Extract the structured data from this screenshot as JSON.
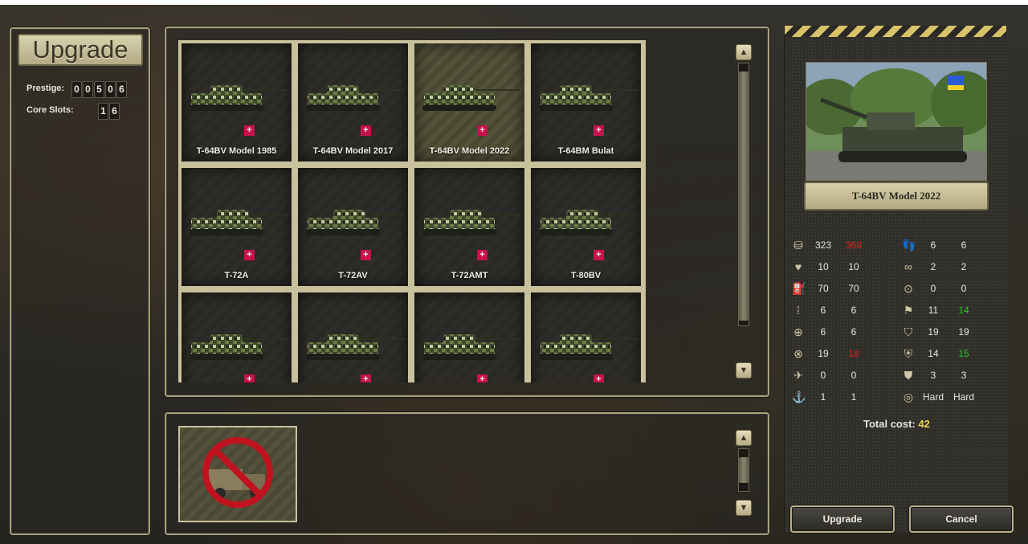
{
  "left": {
    "title": "Upgrade",
    "prestige_label": "Prestige:",
    "prestige_digits": [
      "0",
      "0",
      "5",
      "0",
      "6"
    ],
    "core_slots_label": "Core Slots:",
    "core_slots_digits": [
      "1",
      "6"
    ]
  },
  "units": [
    {
      "name": "T-64BV Model 1985",
      "selected": false
    },
    {
      "name": "T-64BV Model 2017",
      "selected": false
    },
    {
      "name": "T-64BV Model 2022",
      "selected": true
    },
    {
      "name": "T-64BM Bulat",
      "selected": false
    },
    {
      "name": "T-72A",
      "selected": false
    },
    {
      "name": "T-72AV",
      "selected": false
    },
    {
      "name": "T-72AMT",
      "selected": false
    },
    {
      "name": "T-80BV",
      "selected": false
    },
    {
      "name": "",
      "selected": false
    },
    {
      "name": "",
      "selected": false
    },
    {
      "name": "",
      "selected": false
    },
    {
      "name": "",
      "selected": false
    }
  ],
  "right": {
    "unit_title": "T-64BV Model 2022",
    "stats_left": [
      {
        "icon": "cost-icon",
        "a": "323",
        "b": "368",
        "b_color": "red"
      },
      {
        "icon": "heart-icon",
        "a": "10",
        "b": "10",
        "b_color": ""
      },
      {
        "icon": "fuel-icon",
        "a": "70",
        "b": "70",
        "b_color": ""
      },
      {
        "icon": "ammo-icon",
        "a": "6",
        "b": "6",
        "b_color": ""
      },
      {
        "icon": "soft-attack-icon",
        "a": "6",
        "b": "6",
        "b_color": ""
      },
      {
        "icon": "hard-attack-icon",
        "a": "19",
        "b": "18",
        "b_color": "red"
      },
      {
        "icon": "air-attack-icon",
        "a": "0",
        "b": "0",
        "b_color": ""
      },
      {
        "icon": "naval-attack-icon",
        "a": "1",
        "b": "1",
        "b_color": ""
      }
    ],
    "stats_right": [
      {
        "icon": "movement-icon",
        "a": "6",
        "b": "6",
        "b_color": ""
      },
      {
        "icon": "binoculars-icon",
        "a": "2",
        "b": "2",
        "b_color": ""
      },
      {
        "icon": "range-icon",
        "a": "0",
        "b": "0",
        "b_color": ""
      },
      {
        "icon": "initiative-icon",
        "a": "11",
        "b": "14",
        "b_color": "green"
      },
      {
        "icon": "ground-defense-icon",
        "a": "19",
        "b": "19",
        "b_color": ""
      },
      {
        "icon": "air-defense-icon",
        "a": "14",
        "b": "15",
        "b_color": "green"
      },
      {
        "icon": "close-defense-icon",
        "a": "3",
        "b": "3",
        "b_color": ""
      },
      {
        "icon": "target-type-icon",
        "a": "Hard",
        "b": "Hard",
        "b_color": ""
      }
    ],
    "total_label": "Total cost:",
    "total_value": "42",
    "upgrade_label": "Upgrade",
    "cancel_label": "Cancel"
  },
  "colors": {
    "accent": "#a9a07c",
    "red": "#e02020",
    "green": "#21c521",
    "cost": "#ead34a"
  }
}
